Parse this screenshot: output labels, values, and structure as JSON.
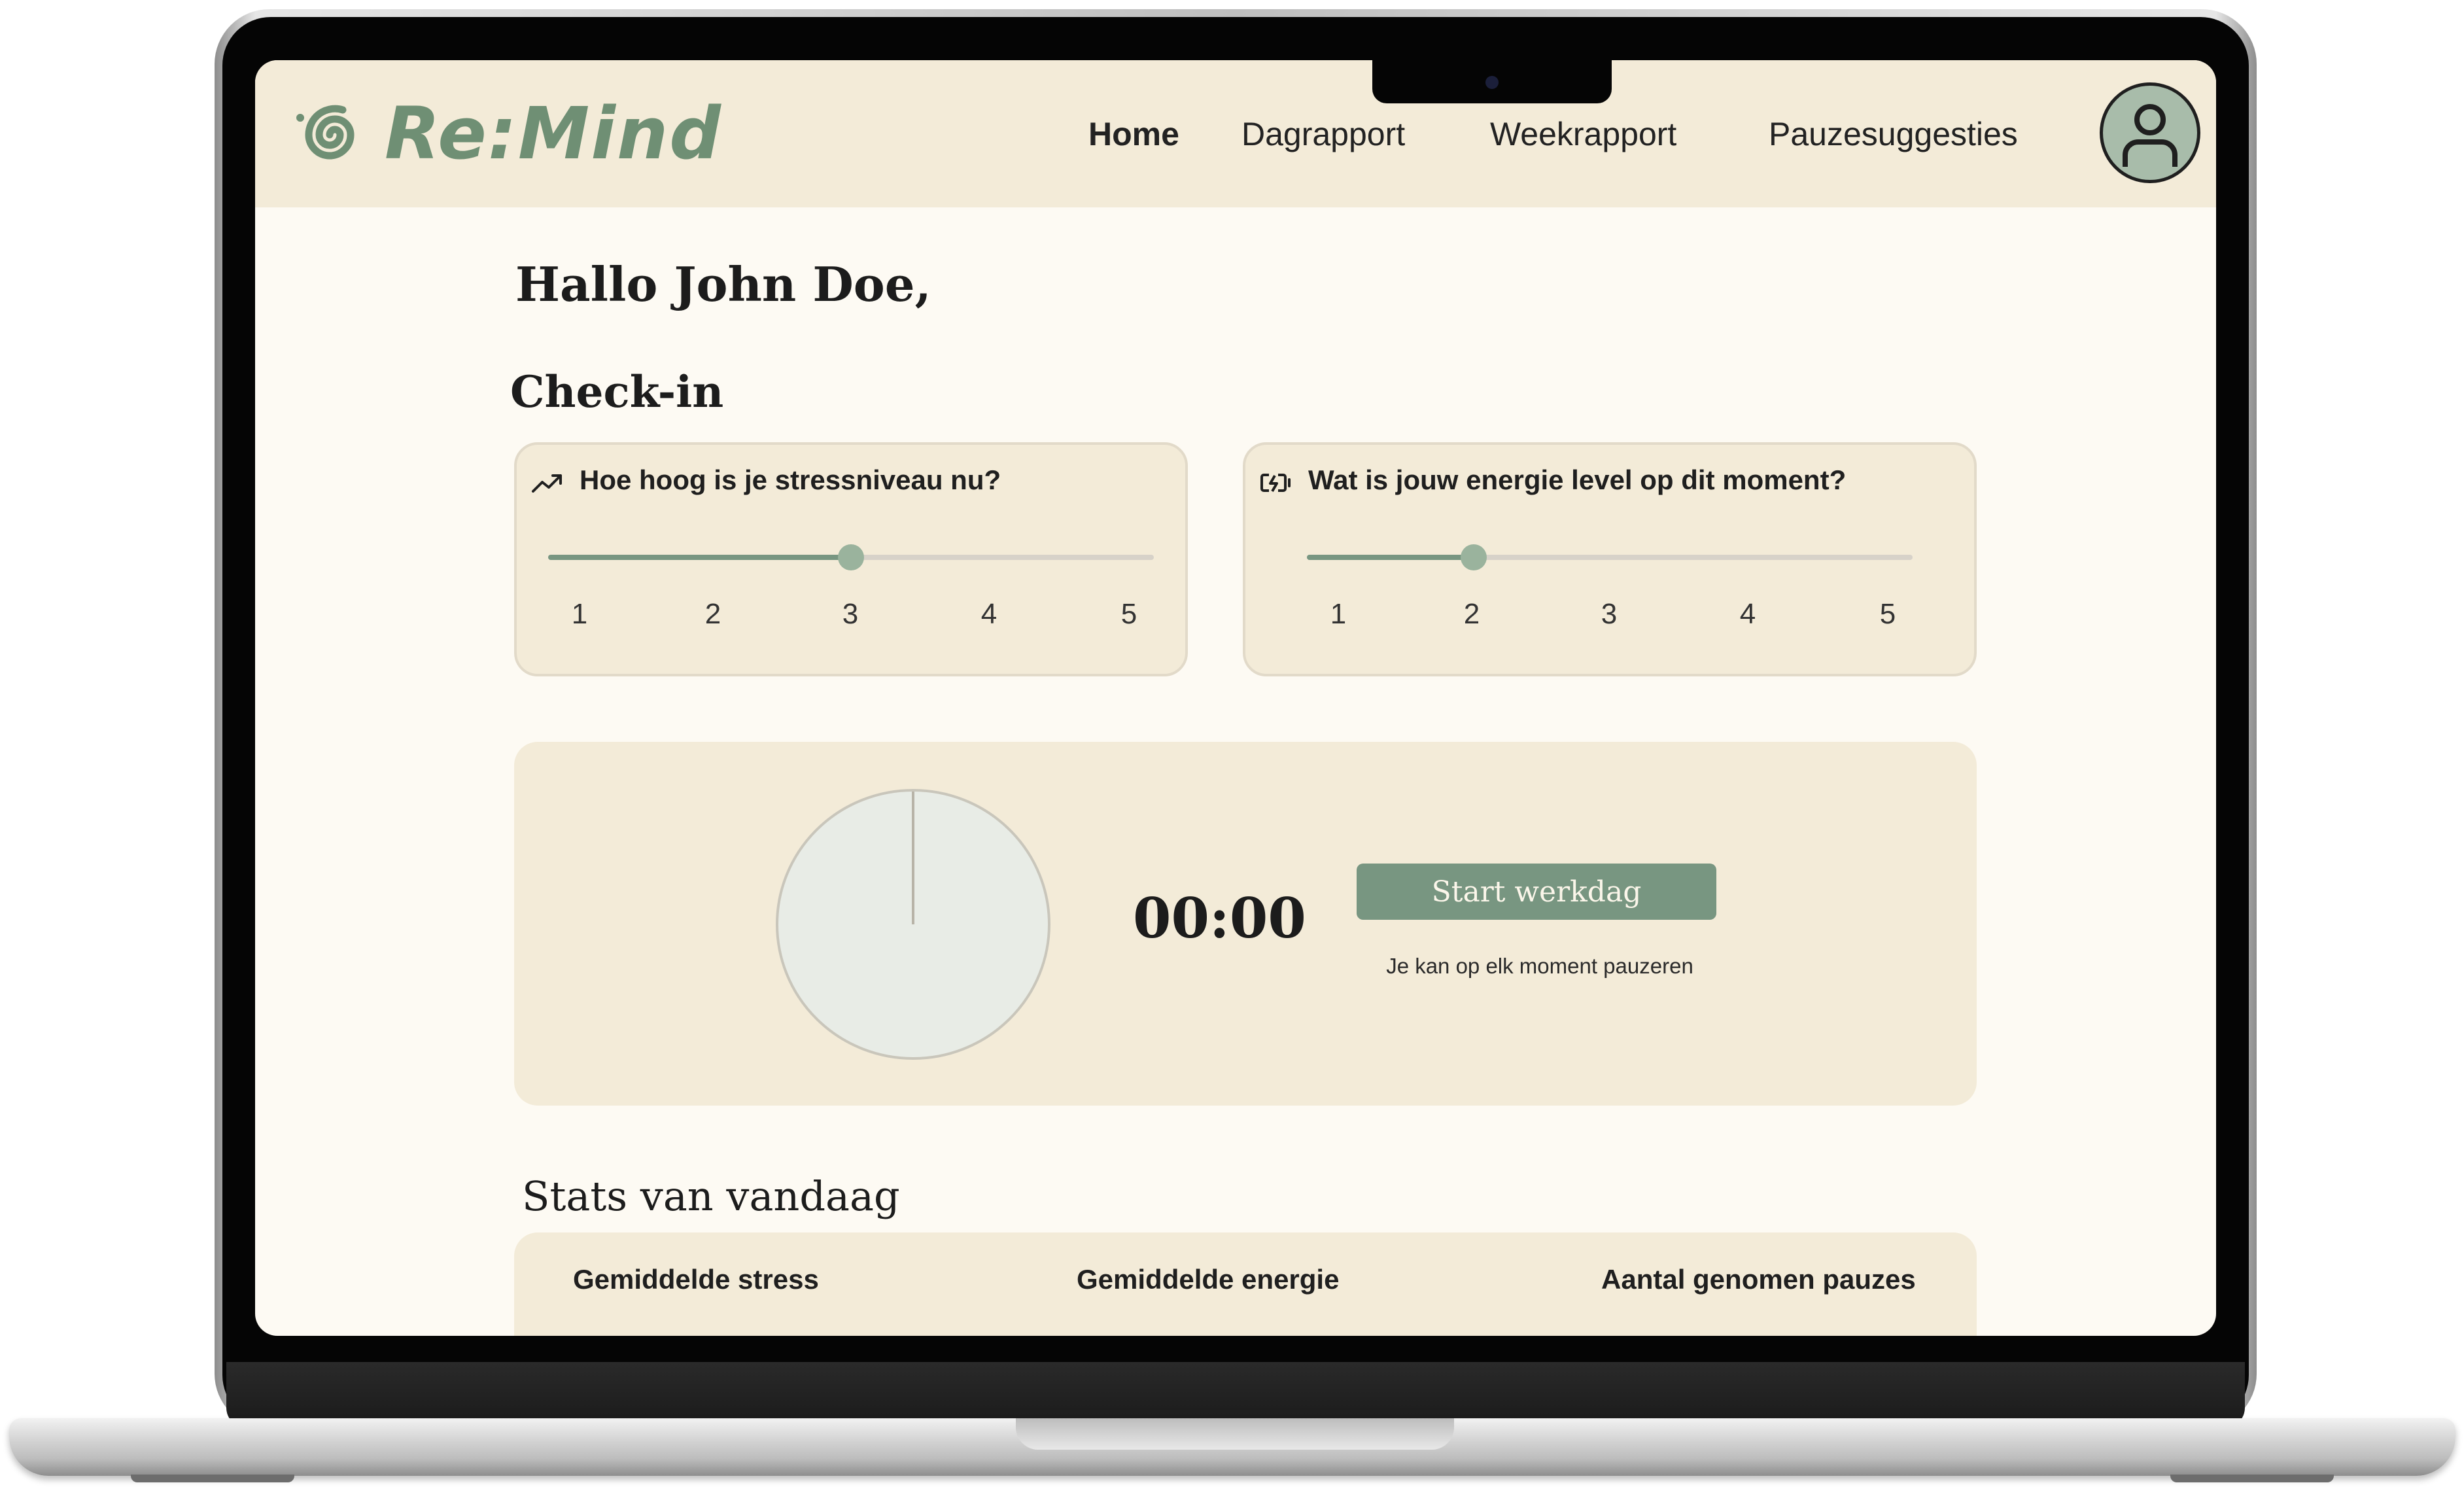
{
  "app": {
    "logo_text": "Re:Mind"
  },
  "nav": {
    "items": [
      {
        "label": "Home",
        "active": true
      },
      {
        "label": "Dagrapport",
        "active": false
      },
      {
        "label": "Weekrapport",
        "active": false
      },
      {
        "label": "Pauzesuggesties",
        "active": false
      }
    ]
  },
  "greeting": "Hallo John Doe,",
  "checkin": {
    "title": "Check-in",
    "stress": {
      "question": "Hoe hoog is je stressniveau nu?",
      "icon": "trending-up-icon",
      "value": 3,
      "scale": [
        "1",
        "2",
        "3",
        "4",
        "5"
      ]
    },
    "energy": {
      "question": "Wat is jouw energie level op dit moment?",
      "icon": "battery-charging-icon",
      "value": 2,
      "scale": [
        "1",
        "2",
        "3",
        "4",
        "5"
      ]
    }
  },
  "timer": {
    "time": "00:00",
    "start_label": "Start werkdag",
    "note": "Je kan op elk moment pauzeren"
  },
  "stats": {
    "title": "Stats van vandaag",
    "headers": [
      "Gemiddelde stress",
      "Gemiddelde energie",
      "Aantal genomen pauzes"
    ]
  },
  "colors": {
    "accent": "#789681",
    "topbar": "#f3ebd8",
    "page_bg": "#fdfaf3",
    "logo": "#6f8f74"
  }
}
